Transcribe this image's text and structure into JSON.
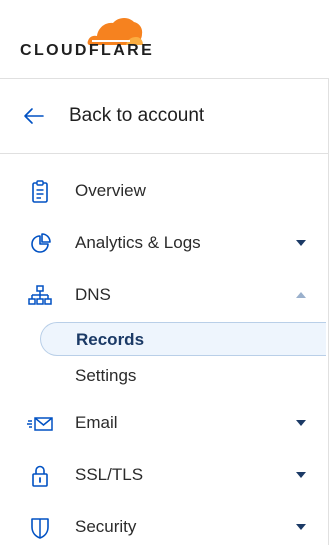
{
  "brand": {
    "logo_text": "CLOUDFLARE",
    "cloud_colors": [
      "#f6821f",
      "#fbad41"
    ]
  },
  "back": {
    "label": "Back to account",
    "icon": "arrow-left-icon"
  },
  "nav": {
    "items": [
      {
        "label": "Overview",
        "icon": "clipboard-icon",
        "expandable": false
      },
      {
        "label": "Analytics & Logs",
        "icon": "pie-chart-icon",
        "expandable": true,
        "expanded": false
      },
      {
        "label": "DNS",
        "icon": "network-icon",
        "expandable": true,
        "expanded": true
      },
      {
        "label": "Email",
        "icon": "email-icon",
        "expandable": true,
        "expanded": false
      },
      {
        "label": "SSL/TLS",
        "icon": "lock-icon",
        "expandable": true,
        "expanded": false
      },
      {
        "label": "Security",
        "icon": "shield-icon",
        "expandable": true,
        "expanded": false
      }
    ],
    "dns_sub": [
      {
        "label": "Records",
        "active": true
      },
      {
        "label": "Settings",
        "active": false
      }
    ]
  },
  "colors": {
    "accent": "#0051c3",
    "active_bg": "#eef5fd",
    "active_text": "#1b3a66"
  }
}
